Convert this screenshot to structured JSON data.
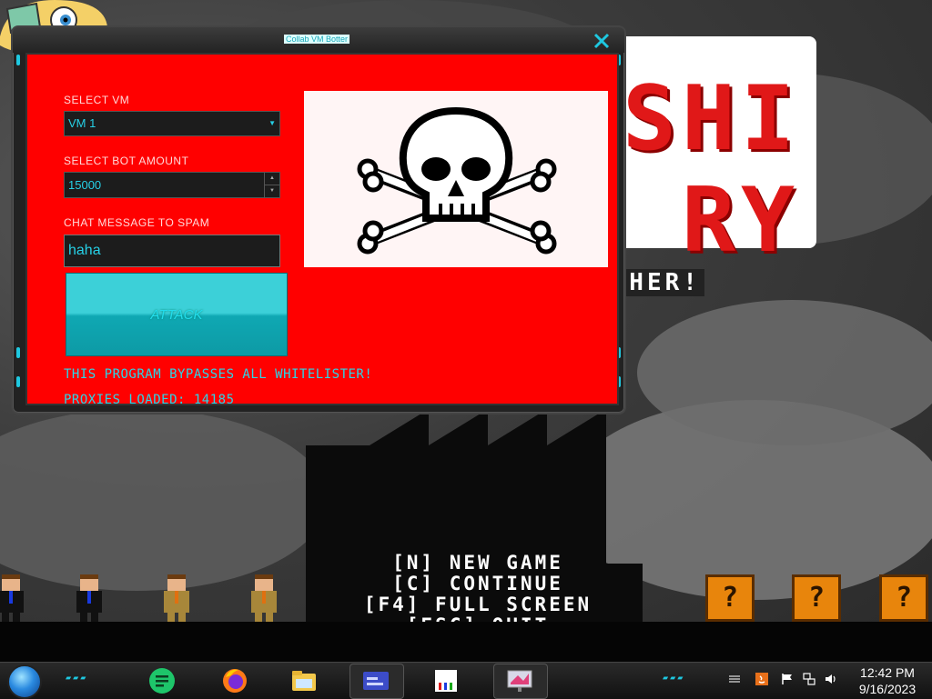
{
  "window": {
    "title": "Collab VM Botter",
    "select_vm_label": "SELECT VM",
    "select_vm_value": "VM 1",
    "bot_amount_label": "SELECT BOT AMOUNT",
    "bot_amount_value": "15000",
    "chat_label": "CHAT MESSAGE TO SPAM",
    "chat_value": "haha",
    "attack_label": "ATTACK",
    "bypass_text": "THIS PROGRAM BYPASSES ALL WHITELISTER!",
    "proxies_text": "PROXIES LOADED: 14185",
    "image_icon": "skull-crossbones-icon"
  },
  "game": {
    "title_line_1": "SHI",
    "title_line_2": "RY",
    "tagline": "ETHER!",
    "menu": [
      "[N] NEW GAME",
      "[C] CONTINUE",
      "[F4] FULL SCREEN",
      "[ESC] QUIT"
    ],
    "block_glyph": "?"
  },
  "taskbar": {
    "apps": [
      "sheets-icon",
      "firefox-icon",
      "file-explorer-icon",
      "app-window-icon",
      "paint-icon",
      "presentation-icon"
    ],
    "time": "12:42 PM",
    "date": "9/16/2023"
  },
  "colors": {
    "window_body": "#ff0000",
    "accent_cyan": "#26d0e6",
    "title_red": "#e01818"
  }
}
